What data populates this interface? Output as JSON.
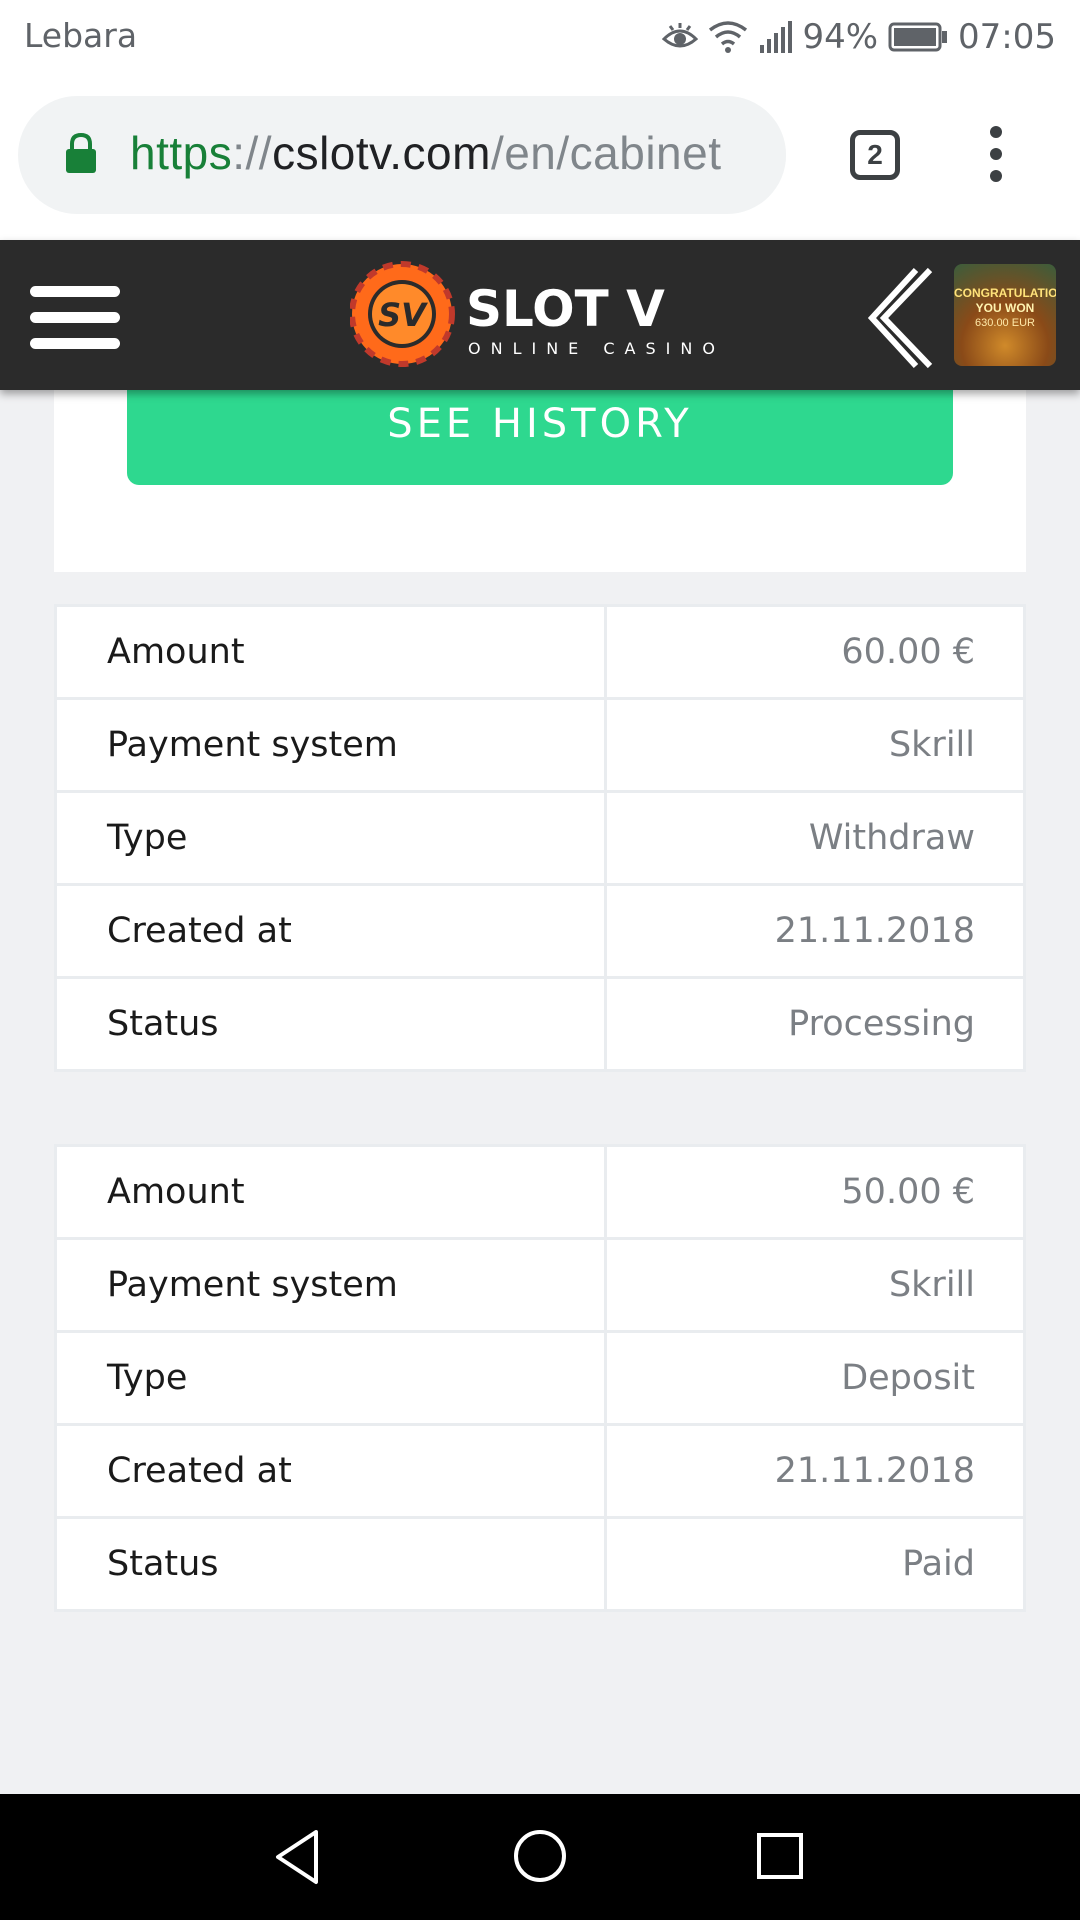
{
  "status_bar": {
    "carrier": "Lebara",
    "battery": "94%",
    "time": "07:05"
  },
  "browser": {
    "url_scheme": "https",
    "url_sep": "://",
    "url_host": "cslotv.com",
    "url_path": "/en/cabinet",
    "tab_count": "2"
  },
  "site": {
    "logo_text": "SLOT V",
    "logo_sub": "ONLINE CASINO",
    "logo_badge": "SV",
    "promo_line1": "CONGRATULATIONS!",
    "promo_line2": "YOU WON",
    "promo_line3": "630.00 EUR"
  },
  "history_button": "SEE HISTORY",
  "transactions": [
    {
      "rows": [
        {
          "label": "Amount",
          "value": "60.00 €"
        },
        {
          "label": "Payment system",
          "value": "Skrill"
        },
        {
          "label": "Type",
          "value": "Withdraw"
        },
        {
          "label": "Created at",
          "value": "21.11.2018"
        },
        {
          "label": "Status",
          "value": "Processing"
        }
      ]
    },
    {
      "rows": [
        {
          "label": "Amount",
          "value": "50.00 €"
        },
        {
          "label": "Payment system",
          "value": "Skrill"
        },
        {
          "label": "Type",
          "value": "Deposit"
        },
        {
          "label": "Created at",
          "value": "21.11.2018"
        },
        {
          "label": "Status",
          "value": "Paid"
        }
      ]
    }
  ],
  "colors": {
    "accent_green": "#2ed88f",
    "header_bg": "#2b2b2b",
    "logo_orange": "#ff6a1a",
    "logo_red": "#e53935"
  },
  "icons": [
    "eye-icon",
    "wifi-icon",
    "signal-icon",
    "battery-icon",
    "lock-icon",
    "menu-dots-icon",
    "hamburger-icon",
    "chevron-left-icon",
    "back-icon",
    "home-icon",
    "recents-icon"
  ]
}
